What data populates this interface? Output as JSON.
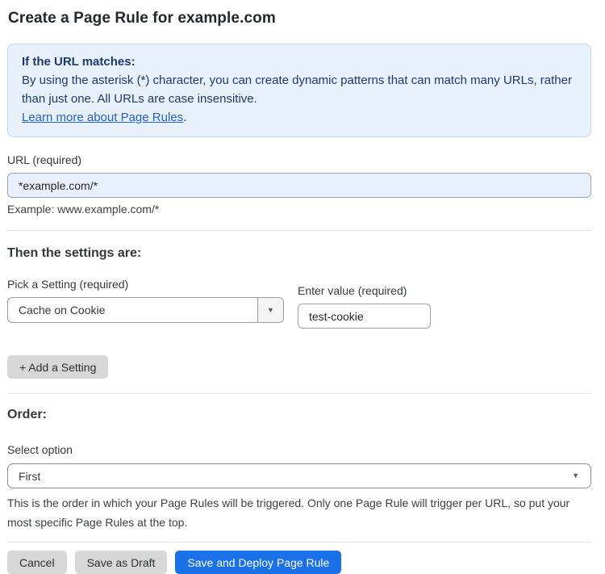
{
  "page": {
    "title": "Create a Page Rule for example.com"
  },
  "info_box": {
    "heading": "If the URL matches:",
    "body": "By using the asterisk (*) character, you can create dynamic patterns that can match many URLs, rather than just one. All URLs are case insensitive.",
    "link": "Learn more about Page Rules",
    "link_suffix": "."
  },
  "url_field": {
    "label": "URL (required)",
    "value": "*example.com/*",
    "example": "Example: www.example.com/*"
  },
  "settings": {
    "heading": "Then the settings are:",
    "setting_label": "Pick a Setting (required)",
    "setting_selected": "Cache on Cookie",
    "value_label": "Enter value (required)",
    "value_text": "test-cookie",
    "add_button_label": "+ Add a Setting"
  },
  "order": {
    "heading": "Order:",
    "label": "Select option",
    "selected": "First",
    "help": "This is the order in which your Page Rules will be triggered. Only one Page Rule will trigger per URL, so put your most specific Page Rules at the top."
  },
  "actions": {
    "cancel": "Cancel",
    "save_draft": "Save as Draft",
    "save_deploy": "Save and Deploy Page Rule"
  },
  "icons": {
    "dropdown_arrow": "▼"
  },
  "colors": {
    "accent_blue": "#1a71e8",
    "info_bg": "#e8f1fb",
    "info_border": "#c5daf2",
    "info_text": "#1d3a6d",
    "link_blue": "#2262c9",
    "autofill_bg": "#e8f0fe",
    "button_gray": "#d7d7d7"
  }
}
